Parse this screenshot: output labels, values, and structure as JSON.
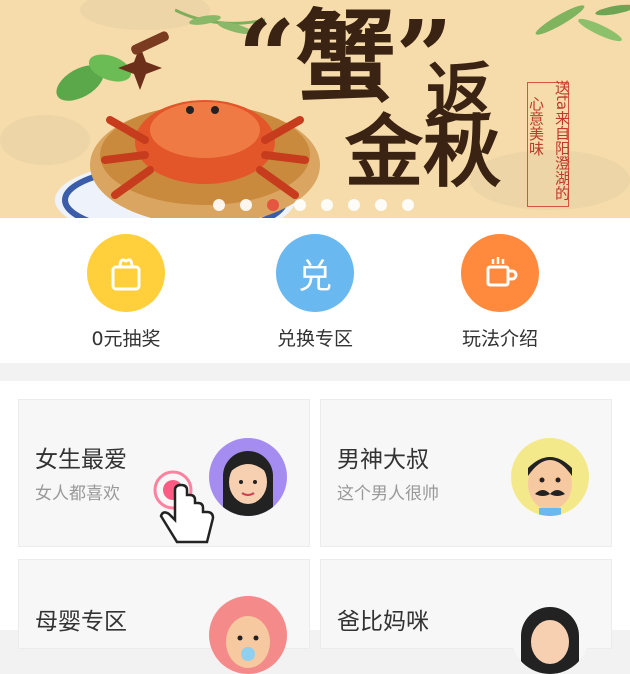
{
  "banner": {
    "title_line1": "“蟹”",
    "title_part2": "返",
    "title_line2": "金秋",
    "slogan_col1": "送ta来自阳澄湖的",
    "slogan_col2": "心意美味",
    "slide_count": 8,
    "active_slide": 3
  },
  "quick": [
    {
      "label": "0元抽奖",
      "icon": "gift-bag-icon",
      "color": "#ffd03b"
    },
    {
      "label": "兑换专区",
      "icon": "exchange-icon",
      "glyph": "兑",
      "color": "#6ab8f0"
    },
    {
      "label": "玩法介绍",
      "icon": "mug-icon",
      "color": "#ff8a3d"
    }
  ],
  "categories": [
    {
      "title": "女生最爱",
      "subtitle": "女人都喜欢",
      "avatar": "woman-avatar-icon"
    },
    {
      "title": "男神大叔",
      "subtitle": "这个男人很帅",
      "avatar": "mustache-man-avatar-icon"
    },
    {
      "title": "母婴专区",
      "avatar": "baby-avatar-icon"
    },
    {
      "title": "爸比妈咪",
      "avatar": "mom-avatar-icon"
    }
  ],
  "colors": {
    "accent": "#e74c3c",
    "gift": "#ffd03b",
    "exchange": "#6ab8f0",
    "mug": "#ff8a3d"
  }
}
